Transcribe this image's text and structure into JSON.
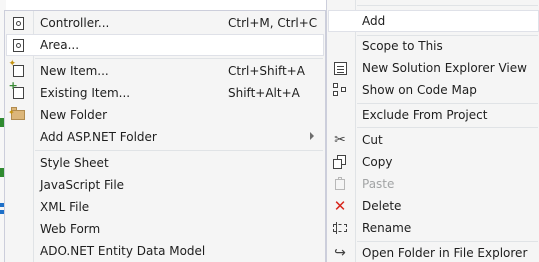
{
  "colors": {
    "menu_bg": "#f5f5f5",
    "menu_border": "#cccedb",
    "highlight_bg": "#ffffff",
    "disabled_text": "#a2a4a5",
    "delete_icon": "#d7261c"
  },
  "add_submenu": {
    "items": [
      {
        "label": "Controller...",
        "shortcut": "Ctrl+M, Ctrl+C",
        "icon": "controller-icon"
      },
      {
        "label": "Area...",
        "shortcut": "",
        "icon": "area-icon",
        "highlighted": true
      },
      {
        "label": "New Item...",
        "shortcut": "Ctrl+Shift+A",
        "icon": "new-item-icon"
      },
      {
        "label": "Existing Item...",
        "shortcut": "Shift+Alt+A",
        "icon": "existing-item-icon"
      },
      {
        "label": "New Folder",
        "shortcut": "",
        "icon": "new-folder-icon"
      },
      {
        "label": "Add ASP.NET Folder",
        "shortcut": "",
        "has_submenu": true
      },
      {
        "label": "Style Sheet",
        "shortcut": ""
      },
      {
        "label": "JavaScript File",
        "shortcut": ""
      },
      {
        "label": "XML File",
        "shortcut": ""
      },
      {
        "label": "Web Form",
        "shortcut": ""
      },
      {
        "label": "ADO.NET Entity Data Model",
        "shortcut": ""
      }
    ]
  },
  "context_menu": {
    "items": [
      {
        "label": "Add",
        "highlighted": true
      },
      {
        "label": "Scope to This"
      },
      {
        "label": "New Solution Explorer View",
        "icon": "solution-explorer-icon"
      },
      {
        "label": "Show on Code Map",
        "icon": "code-map-icon"
      },
      {
        "label": "Exclude From Project"
      },
      {
        "label": "Cut",
        "icon": "cut-icon"
      },
      {
        "label": "Copy",
        "icon": "copy-icon"
      },
      {
        "label": "Paste",
        "icon": "paste-icon",
        "disabled": true
      },
      {
        "label": "Delete",
        "icon": "delete-icon"
      },
      {
        "label": "Rename",
        "icon": "rename-icon"
      },
      {
        "label": "Open Folder in File Explorer",
        "icon": "open-folder-icon"
      }
    ]
  }
}
